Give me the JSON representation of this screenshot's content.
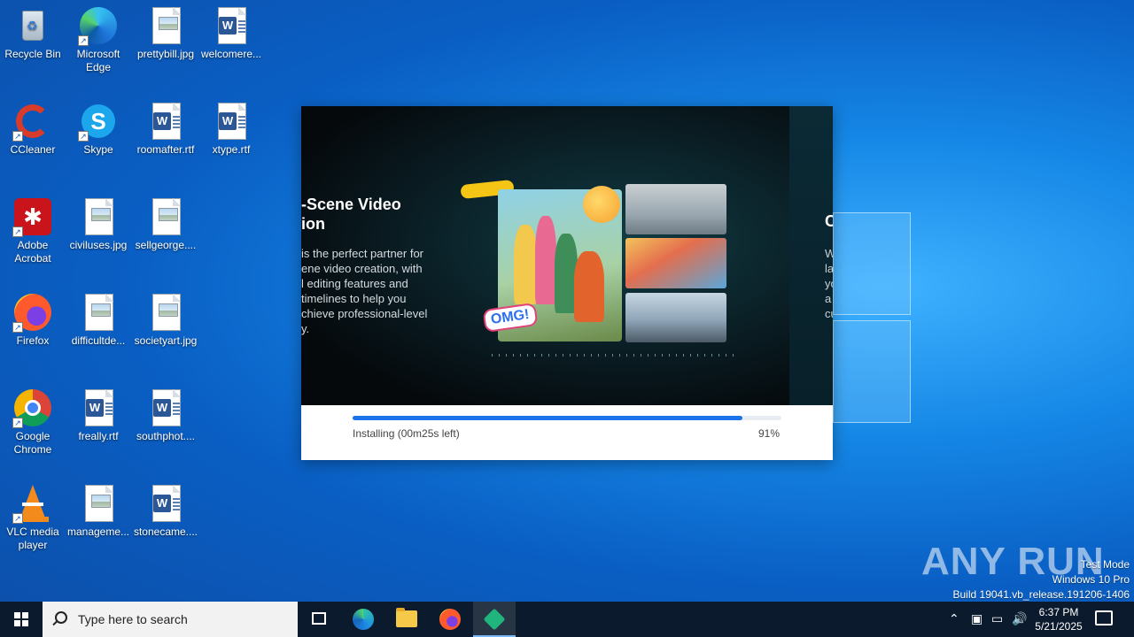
{
  "desktop": {
    "icons": [
      {
        "label": "Recycle Bin",
        "icon": "recycle-bin-icon"
      },
      {
        "label": "Microsoft Edge",
        "icon": "edge-icon"
      },
      {
        "label": "prettybill.jpg",
        "icon": "image-file-icon"
      },
      {
        "label": "welcomere...",
        "icon": "word-doc-icon"
      },
      {
        "label": "CCleaner",
        "icon": "ccleaner-icon"
      },
      {
        "label": "Skype",
        "icon": "skype-icon"
      },
      {
        "label": "roomafter.rtf",
        "icon": "word-doc-icon"
      },
      {
        "label": "xtype.rtf",
        "icon": "word-doc-icon"
      },
      {
        "label": "Adobe Acrobat",
        "icon": "acrobat-icon"
      },
      {
        "label": "civiluses.jpg",
        "icon": "image-file-icon"
      },
      {
        "label": "sellgeorge....",
        "icon": "image-file-icon"
      },
      {
        "label": "Firefox",
        "icon": "firefox-icon"
      },
      {
        "label": "difficultde...",
        "icon": "image-file-icon"
      },
      {
        "label": "societyart.jpg",
        "icon": "image-file-icon"
      },
      {
        "label": "Google Chrome",
        "icon": "chrome-icon"
      },
      {
        "label": "freally.rtf",
        "icon": "word-doc-icon"
      },
      {
        "label": "southphot....",
        "icon": "word-doc-icon"
      },
      {
        "label": "VLC media player",
        "icon": "vlc-icon"
      },
      {
        "label": "manageme...",
        "icon": "image-file-icon"
      },
      {
        "label": "stonecame....",
        "icon": "word-doc-icon"
      }
    ]
  },
  "installer": {
    "slide": {
      "title_line1": "-Scene Video",
      "title_line2": "ion",
      "desc_lines": [
        "is the perfect partner for",
        "ene video creation, with",
        "l editing features and",
        "timelines to help you",
        "chieve professional-level",
        "y."
      ],
      "sticker_text": "OMG!",
      "next_slide_letter": "C",
      "next_slide_lines": [
        "W",
        "la",
        "yo",
        "a",
        "cu"
      ]
    },
    "progress": {
      "status": "Installing (00m25s left)",
      "percent_label": "91%",
      "percent": 91
    }
  },
  "watermark": {
    "text": "ANY RUN",
    "lines": [
      "Test Mode",
      "Windows 10 Pro",
      "Build 19041.vb_release.191206-1406"
    ]
  },
  "taskbar": {
    "search_placeholder": "Type here to search",
    "apps": [
      "task-view",
      "edge",
      "file-explorer",
      "firefox",
      "installer"
    ],
    "clock_time": "6:37 PM",
    "clock_date": "5/21/2025",
    "tray_icons": [
      "chevron-up-icon",
      "meet-now-icon",
      "network-icon",
      "volume-icon"
    ]
  }
}
